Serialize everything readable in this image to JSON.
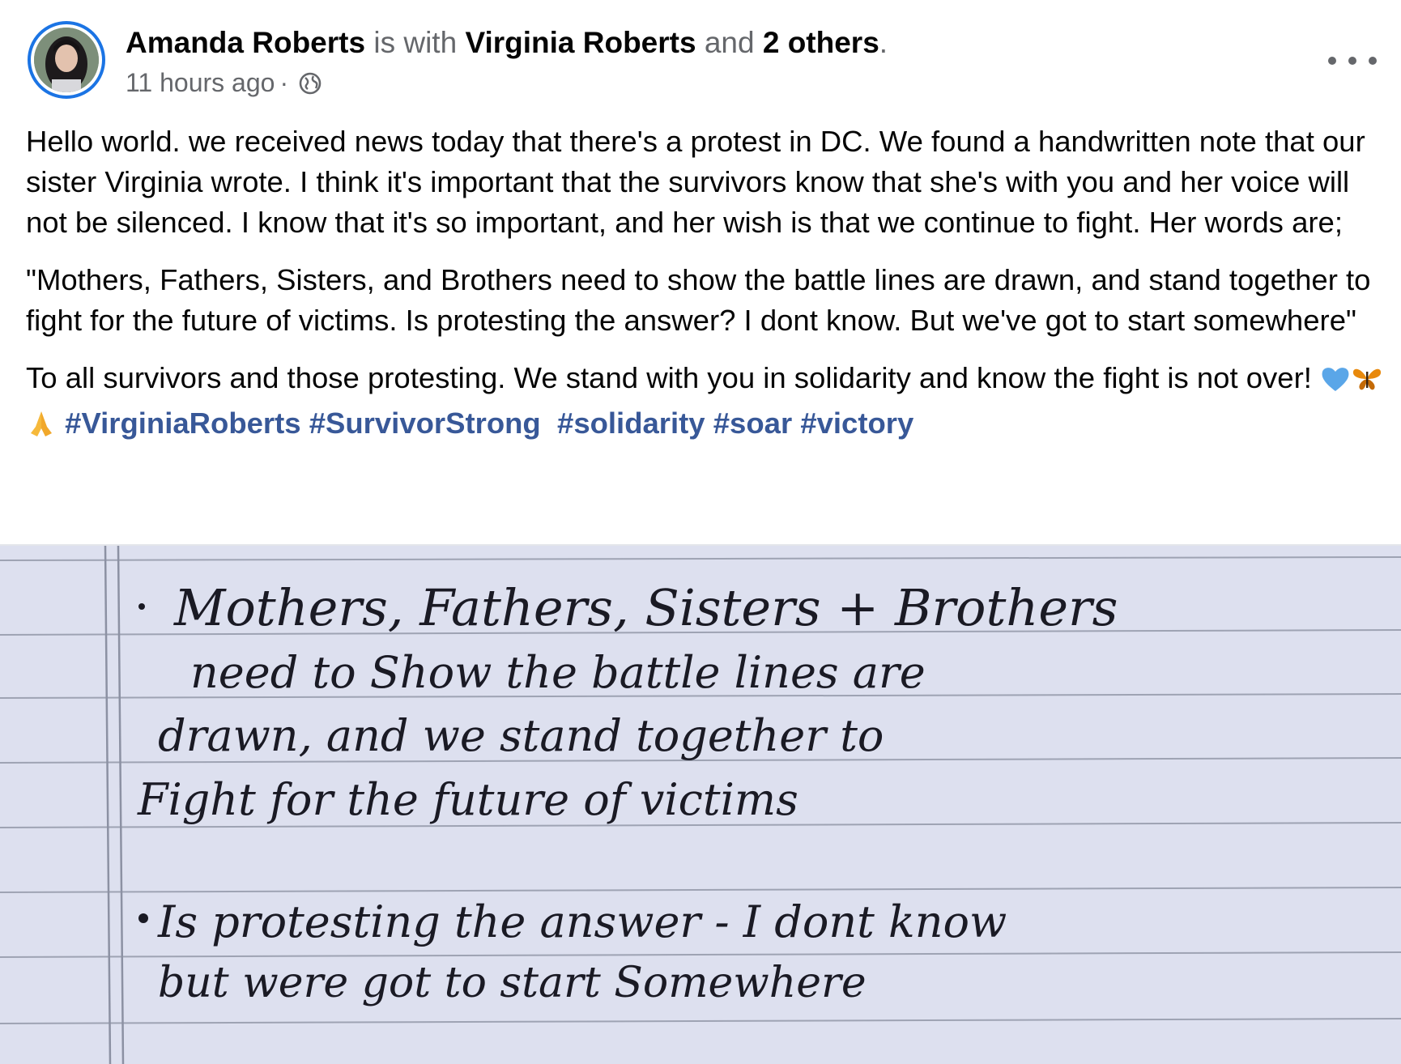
{
  "post": {
    "author": "Amanda Roberts",
    "is_with": "is with",
    "tagged_person": "Virginia Roberts",
    "and_word": "and",
    "others": "2 others",
    "period": ".",
    "timestamp": "11 hours ago",
    "separator": "·",
    "privacy_icon": "globe-icon",
    "more_icon": "more-options-icon"
  },
  "content": {
    "paragraph_1": "Hello world. we received news today that there's a protest in DC. We found a handwritten note that our sister Virginia wrote. I think it's important that the survivors know that she's with you and her voice will not be silenced. I know that it's so important, and her wish is that we continue to fight. Her words are;",
    "paragraph_2": "\"Mothers, Fathers, Sisters, and Brothers need to show the battle lines are drawn, and stand together to fight for the future of victims. Is protesting the answer? I dont know. But we've got to start somewhere\"",
    "paragraph_3": "To all survivors and those protesting. We stand with you in solidarity and know the fight is not over!",
    "emojis": [
      "blue-heart",
      "butterfly",
      "folded-hands"
    ],
    "hashtags": [
      "#VirginiaRoberts",
      "#SurvivorStrong",
      "#solidarity",
      "#soar",
      "#victory"
    ]
  },
  "note": {
    "lines": [
      "Mothers, Fathers, Sisters + Brothers",
      "need to Show the battle lines are",
      "drawn, and we stand together to",
      "Fight for the future of victims",
      "Is protesting the answer - I dont know",
      "but were got to start Somewhere"
    ]
  }
}
